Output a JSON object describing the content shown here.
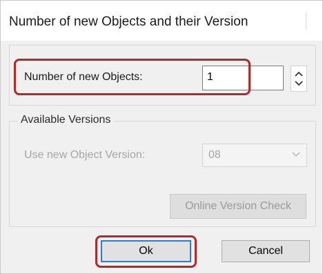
{
  "dialog": {
    "title": "Number of new Objects and their Version"
  },
  "objects": {
    "label": "Number of new Objects:",
    "value": "1",
    "spinner_icon": "up-down-arrows-icon"
  },
  "versions": {
    "group_label": "Available Versions",
    "version_label": "Use new Object Version:",
    "selected_version": "08",
    "dropdown_icon": "chevron-down-icon",
    "online_check_label": "Online Version Check",
    "enabled": false
  },
  "buttons": {
    "ok_label": "Ok",
    "cancel_label": "Cancel"
  },
  "annotations": {
    "highlight_color": "#b12a2a",
    "focus_color": "#2f7bd4"
  }
}
